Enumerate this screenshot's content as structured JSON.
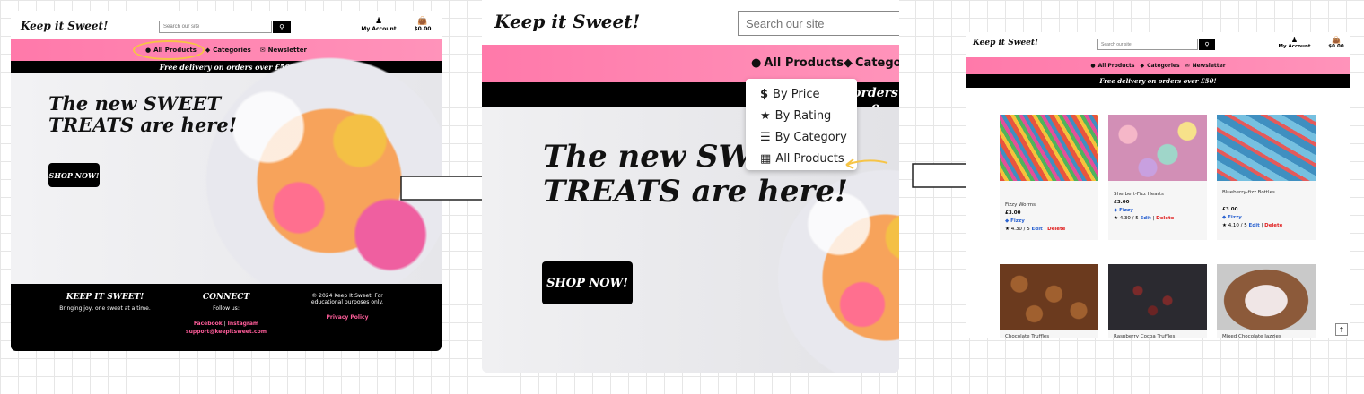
{
  "brand": "Keep it Sweet!",
  "search": {
    "placeholder": "Search our site"
  },
  "account": {
    "label": "My Account"
  },
  "bag": {
    "total": "$0.00"
  },
  "nav": {
    "all_products": "All Products",
    "categories": "Categories",
    "categories_short": "Catego",
    "newsletter": "Newsletter"
  },
  "banner": {
    "text": "Free delivery on orders over £50!",
    "partial": "orders o"
  },
  "hero": {
    "title_line1": "The new SWEET",
    "title_line1_cut": "The new SWEE",
    "title_line2": "TREATS are here!",
    "shop_button": "SHOP NOW!"
  },
  "footer": {
    "col1_heading": "KEEP IT SWEET!",
    "col1_text": "Bringing joy, one sweet at a time.",
    "col2_heading": "CONNECT",
    "col2_text": "Follow us:",
    "facebook": "Facebook",
    "separator": "|",
    "instagram": "Instagram",
    "email": "support@keepitsweet.com",
    "col3_text1": "© 2024 Keep It Sweet. For",
    "col3_text2": "educational purposes only.",
    "privacy": "Privacy Policy"
  },
  "dropdown": {
    "items": [
      {
        "label": "By Price",
        "icon": "dollar-icon"
      },
      {
        "label": "By Rating",
        "icon": "star-icon"
      },
      {
        "label": "By Category",
        "icon": "layers-icon"
      },
      {
        "label": "All Products",
        "icon": "grid-icon"
      }
    ]
  },
  "products": [
    {
      "name": "Fizzy Worms",
      "price": "£3.00",
      "category": "Fizzy",
      "rating": "4.30 / 5",
      "edit": "Edit",
      "delete": "Delete",
      "color": "#e8553e"
    },
    {
      "name": "Sherbert-Fizz Hearts",
      "price": "£3.00",
      "category": "Fizzy",
      "rating": "4.30 / 5",
      "edit": "Edit",
      "delete": "Delete",
      "color": "#b98ad0"
    },
    {
      "name": "Blueberry-fizz Bottles",
      "price": "£3.00",
      "category": "Fizzy",
      "rating": "4.10 / 5",
      "edit": "Edit",
      "delete": "Delete",
      "color": "#3f8fc0"
    },
    {
      "name": "Chocolate Truffles",
      "color": "#6b3a1e"
    },
    {
      "name": "Raspberry Cocoa Truffles",
      "color": "#2b2a30"
    },
    {
      "name": "Mixed Chocolate Jazzies",
      "color": "#8c5a3a"
    }
  ],
  "colors": {
    "pink": "#ff79aa",
    "accent_link": "#ff5d9a",
    "annotation": "#f6c445"
  }
}
